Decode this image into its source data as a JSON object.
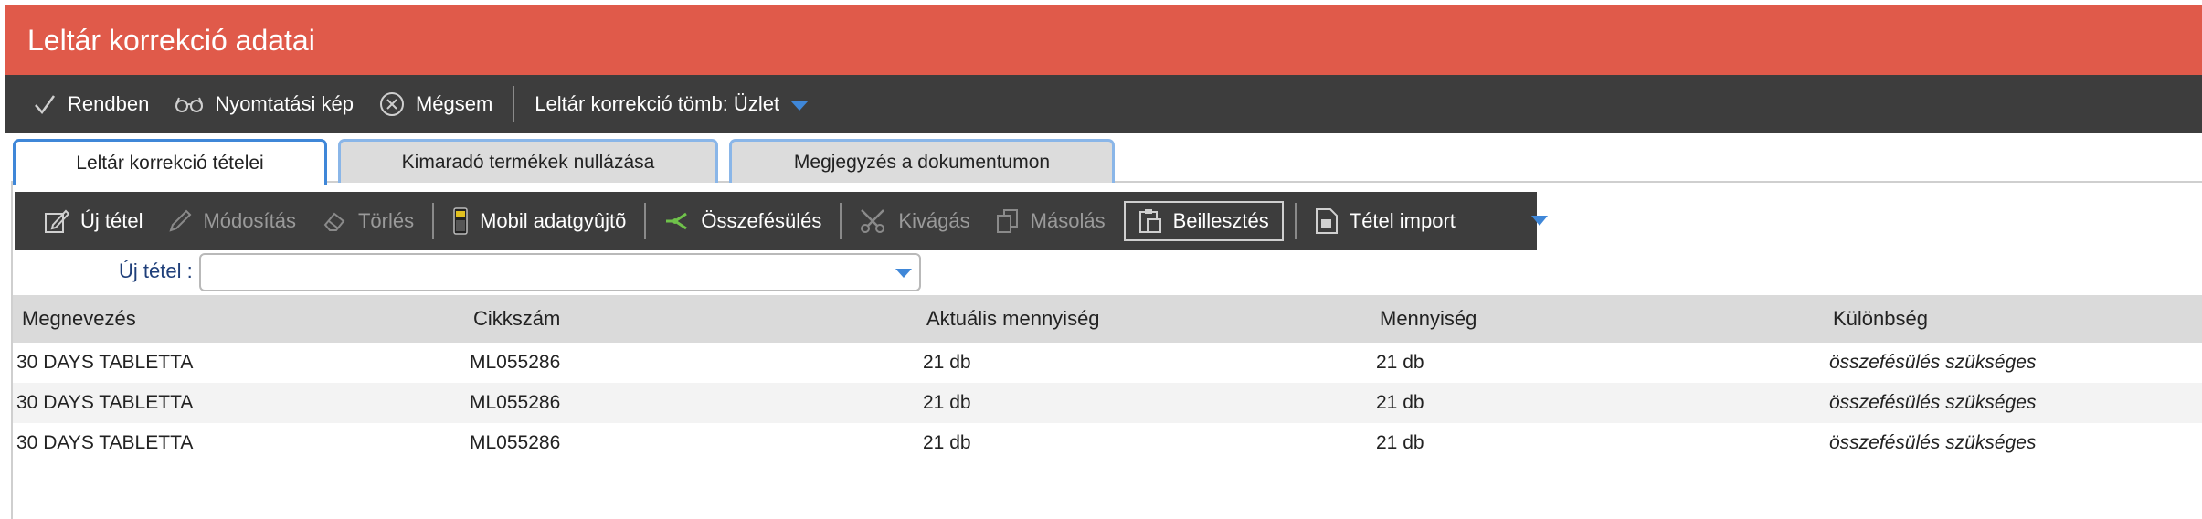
{
  "window": {
    "title": "Leltár korrekció adatai"
  },
  "toolbar": {
    "ok_label": "Rendben",
    "print_preview_label": "Nyomtatási kép",
    "cancel_label": "Mégsem",
    "block_label": "Leltár korrekció tömb: Üzlet"
  },
  "tabs": [
    {
      "label": "Leltár korrekció tételei",
      "active": true
    },
    {
      "label": "Kimaradó termékek nullázása",
      "active": false
    },
    {
      "label": "Megjegyzés a dokumentumon",
      "active": false
    }
  ],
  "items_toolbar": {
    "new_item": "Új tétel",
    "modify": "Módosítás",
    "delete": "Törlés",
    "mobile_collector": "Mobil adatgyûjtõ",
    "merge": "Összefésülés",
    "cut": "Kivágás",
    "copy": "Másolás",
    "paste": "Beillesztés",
    "import": "Tétel import"
  },
  "new_item_field": {
    "label": "Új tétel :",
    "value": ""
  },
  "table": {
    "columns": [
      "Megnevezés",
      "Cikkszám",
      "Aktuális mennyiség",
      "Mennyiség",
      "Különbség"
    ],
    "rows": [
      [
        "30 DAYS TABLETTA",
        "ML055286",
        "21 db",
        "21 db",
        "összefésülés szükséges"
      ],
      [
        "30 DAYS TABLETTA",
        "ML055286",
        "21 db",
        "21 db",
        "összefésülés szükséges"
      ],
      [
        "30 DAYS TABLETTA",
        "ML055286",
        "21 db",
        "21 db",
        "összefésülés szükséges"
      ]
    ]
  },
  "colors": {
    "title_bar": "#e05a4a",
    "toolbar": "#3d3d3d",
    "accent": "#3f87d8",
    "header_row": "#dadada"
  },
  "icons": [
    "checkmark-icon",
    "glasses-icon",
    "close-circle-icon",
    "chevron-down-icon",
    "edit-icon",
    "pencil-icon",
    "eraser-icon",
    "mobile-device-icon",
    "merge-icon",
    "scissors-icon",
    "copy-icon",
    "paste-icon",
    "import-icon"
  ]
}
